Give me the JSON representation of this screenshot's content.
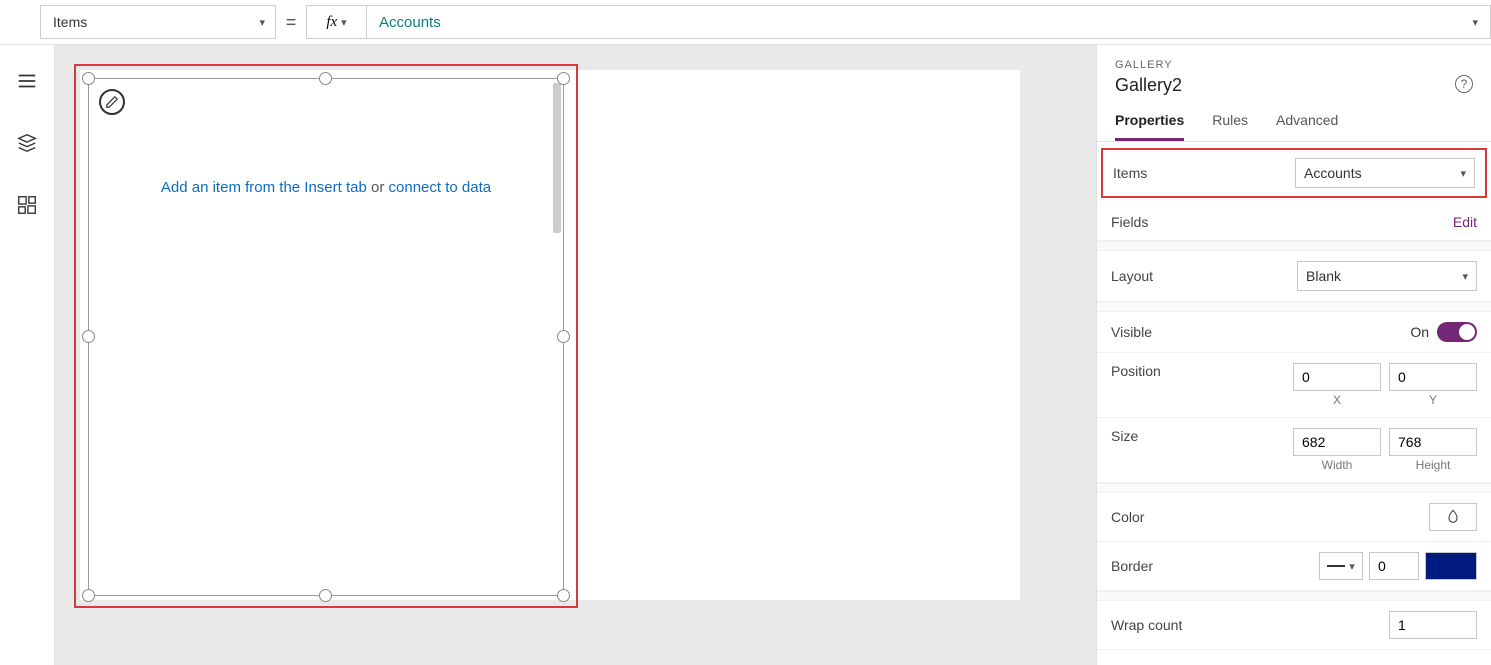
{
  "formulaBar": {
    "property": "Items",
    "value": "Accounts"
  },
  "canvas": {
    "hintPrefix": "Add an item from the Insert tab",
    "hintOr": " or ",
    "hintLink": "connect to data"
  },
  "panel": {
    "type": "GALLERY",
    "name": "Gallery2",
    "tabs": {
      "properties": "Properties",
      "rules": "Rules",
      "advanced": "Advanced"
    },
    "items": {
      "label": "Items",
      "value": "Accounts"
    },
    "fields": {
      "label": "Fields",
      "action": "Edit"
    },
    "layout": {
      "label": "Layout",
      "value": "Blank"
    },
    "visible": {
      "label": "Visible",
      "state": "On"
    },
    "position": {
      "label": "Position",
      "x": "0",
      "y": "0",
      "xLabel": "X",
      "yLabel": "Y"
    },
    "size": {
      "label": "Size",
      "w": "682",
      "h": "768",
      "wLabel": "Width",
      "hLabel": "Height"
    },
    "color": {
      "label": "Color"
    },
    "border": {
      "label": "Border",
      "width": "0"
    },
    "wrap": {
      "label": "Wrap count",
      "value": "1"
    }
  }
}
